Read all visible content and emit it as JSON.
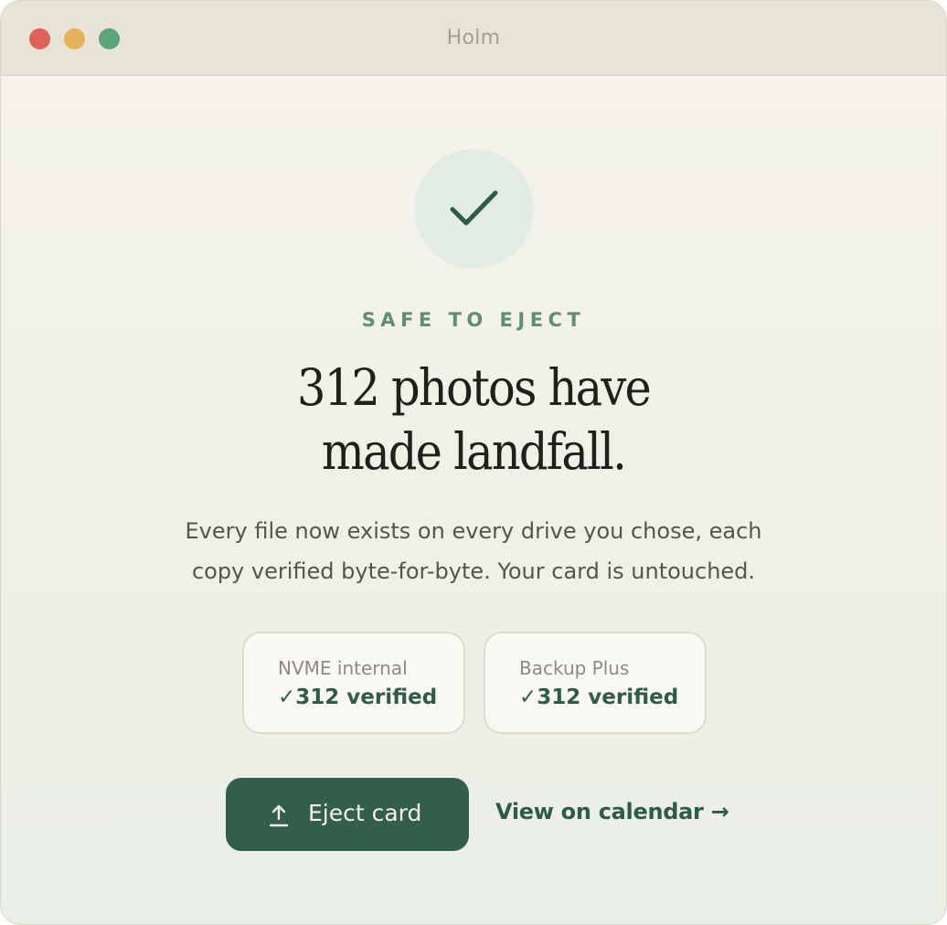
{
  "window": {
    "title": "Holm"
  },
  "status": {
    "kicker": "SAFE TO EJECT",
    "headline_line1": "312 photos have",
    "headline_line2": "made landfall.",
    "subtext_line1": "Every file now exists on every drive you chose, each",
    "subtext_line2": "copy verified byte-for-byte. Your card is untouched."
  },
  "drives": [
    {
      "name": "NVME internal",
      "status": "✓312 verified"
    },
    {
      "name": "Backup Plus",
      "status": "✓312 verified"
    }
  ],
  "actions": {
    "eject_label": "Eject card",
    "calendar_label": "View on calendar →"
  },
  "colors": {
    "accent": "#335e4b",
    "kicker": "#5d8f71",
    "close": "#e0605a",
    "minimize": "#e4b25a",
    "zoom": "#5aa57a"
  },
  "icons": {
    "status": "checkmark-icon",
    "eject": "upload-arrow-icon"
  }
}
